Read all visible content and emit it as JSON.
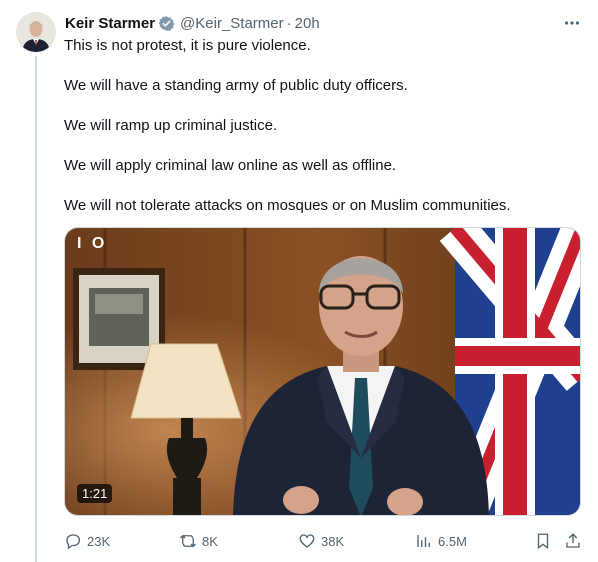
{
  "author": {
    "name": "Keir Starmer",
    "handle": "@Keir_Starmer",
    "separator": "·",
    "time": "20h"
  },
  "tweet": {
    "lines": [
      "This is not protest, it is pure violence.",
      "We will have a standing army of public duty officers.",
      "We will ramp up criminal justice.",
      "We will apply criminal law online as well as offline.",
      "We will not tolerate attacks on mosques or on Muslim communities."
    ]
  },
  "media": {
    "logo": "I O",
    "duration": "1:21"
  },
  "actions": {
    "replies": "23K",
    "retweets": "8K",
    "likes": "38K",
    "views": "6.5M"
  },
  "icons": [
    "verified-icon",
    "more-icon",
    "reply-icon",
    "retweet-icon",
    "like-icon",
    "views-icon",
    "bookmark-icon",
    "share-icon"
  ],
  "colors": {
    "verified": "#829aab",
    "secondary_text": "#536471",
    "text": "#0f1419"
  }
}
